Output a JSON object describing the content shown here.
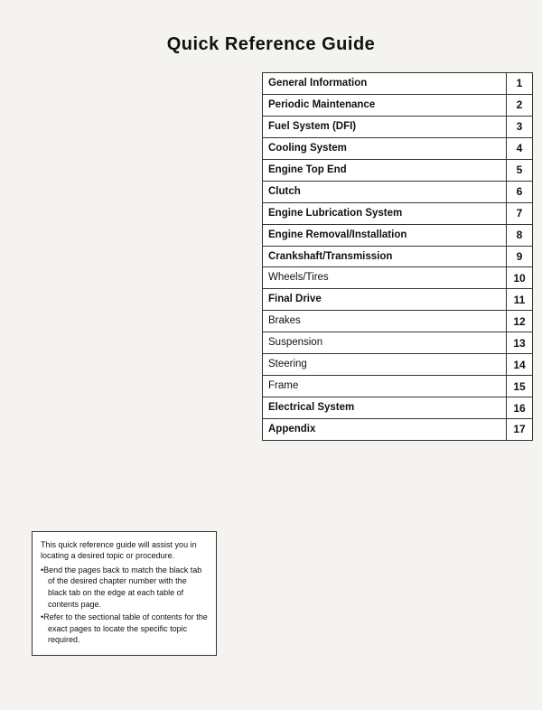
{
  "page": {
    "title": "Quick Reference Guide",
    "toc": [
      {
        "label": "General Information",
        "num": "1",
        "bold": true
      },
      {
        "label": "Periodic Maintenance",
        "num": "2",
        "bold": true
      },
      {
        "label": "Fuel System (DFI)",
        "num": "3",
        "bold": true
      },
      {
        "label": "Cooling System",
        "num": "4",
        "bold": true
      },
      {
        "label": "Engine Top End",
        "num": "5",
        "bold": true
      },
      {
        "label": "Clutch",
        "num": "6",
        "bold": true
      },
      {
        "label": "Engine Lubrication System",
        "num": "7",
        "bold": true
      },
      {
        "label": "Engine Removal/Installation",
        "num": "8",
        "bold": true
      },
      {
        "label": "Crankshaft/Transmission",
        "num": "9",
        "bold": true
      },
      {
        "label": "Wheels/Tires",
        "num": "10",
        "bold": false
      },
      {
        "label": "Final Drive",
        "num": "11",
        "bold": true
      },
      {
        "label": "Brakes",
        "num": "12",
        "bold": false
      },
      {
        "label": "Suspension",
        "num": "13",
        "bold": false
      },
      {
        "label": "Steering",
        "num": "14",
        "bold": false
      },
      {
        "label": "Frame",
        "num": "15",
        "bold": false
      },
      {
        "label": "Electrical System",
        "num": "16",
        "bold": true
      },
      {
        "label": "Appendix",
        "num": "17",
        "bold": true
      }
    ],
    "info_box": {
      "intro": "This quick reference guide will assist you in locating a desired topic or procedure.",
      "bullets": [
        "Bend the pages back to match the black tab of the desired chapter number with the black tab on the edge at each table of contents page.",
        "Refer to the sectional table of contents for the exact pages to locate the specific topic required."
      ]
    }
  }
}
